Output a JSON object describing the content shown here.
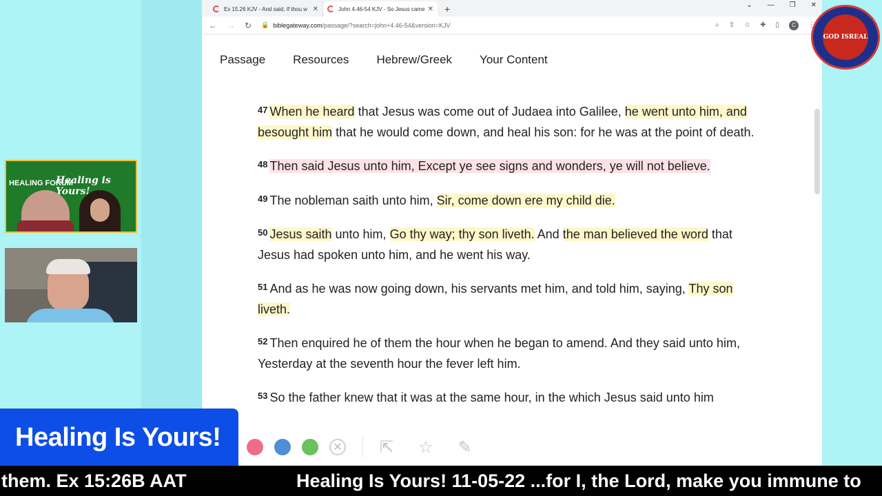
{
  "browser": {
    "tabs": [
      {
        "title": "Ex 15.26 KJV - And said, If thou w",
        "active": false
      },
      {
        "title": "John 4.46-54 KJV - So Jesus came",
        "active": true
      }
    ],
    "url_host": "biblegateway.com",
    "url_path": "/passage/?search=john+4.46-54&version=KJV",
    "profile_initial": "C"
  },
  "sitenav": {
    "items": [
      "Passage",
      "Resources",
      "Hebrew/Greek",
      "Your Content"
    ]
  },
  "verses": {
    "v47": {
      "num": "47",
      "a": "When he heard",
      "b": " that Jesus was come out of Judaea into Galilee, ",
      "c": "he went unto him, and besought him",
      "d": " that he would come down, and heal his son: for he was at the point of death."
    },
    "v48": {
      "num": "48",
      "a": "Then said Jesus unto him, Except ye see signs and wonders, ye will not believe."
    },
    "v49": {
      "num": "49",
      "a": "The nobleman saith unto him, ",
      "b": "Sir, come down ere my child die."
    },
    "v50": {
      "num": "50",
      "a": "Jesus saith",
      "b": " unto him, ",
      "c": "Go thy way; thy son liveth.",
      "d": " And ",
      "e": "the man believed the word",
      "f": " that Jesus had spoken unto him, and he went his way."
    },
    "v51": {
      "num": "51",
      "a": "And as he was now going down, his servants met him, and told him, saying, ",
      "b": "Thy son liveth."
    },
    "v52": {
      "num": "52",
      "a": "Then enquired he of them the hour when he began to amend. And they said unto him, Yesterday at the seventh hour the fever left him."
    },
    "v53": {
      "num": "53",
      "a": "So the father knew that it was at the same hour, in the which Jesus said unto him"
    }
  },
  "overlay": {
    "title_card": "Healing Is Yours!",
    "video1_left_text": "HEALING FORUM",
    "video1_right_text": "Healing is Yours!",
    "ticker_left": "them. Ex 15:26B AAT",
    "ticker_right": "Healing Is Yours! 11-05-22 ...for I, the Lord, make you immune to",
    "logo_text": "GOD ISREAL"
  },
  "colors": {
    "highlight_yellow": "#fff7c9",
    "highlight_pink": "#fde2e8",
    "title_card_blue": "#0d4ee6",
    "background_cyan": "#aef3f6"
  },
  "icons": [
    "back-arrow-icon",
    "forward-arrow-icon",
    "reload-icon",
    "lock-icon",
    "zoom-icon",
    "share-icon",
    "star-icon",
    "extensions-icon",
    "sidepanel-icon",
    "share-external-icon",
    "favorite-icon",
    "edit-note-icon"
  ]
}
